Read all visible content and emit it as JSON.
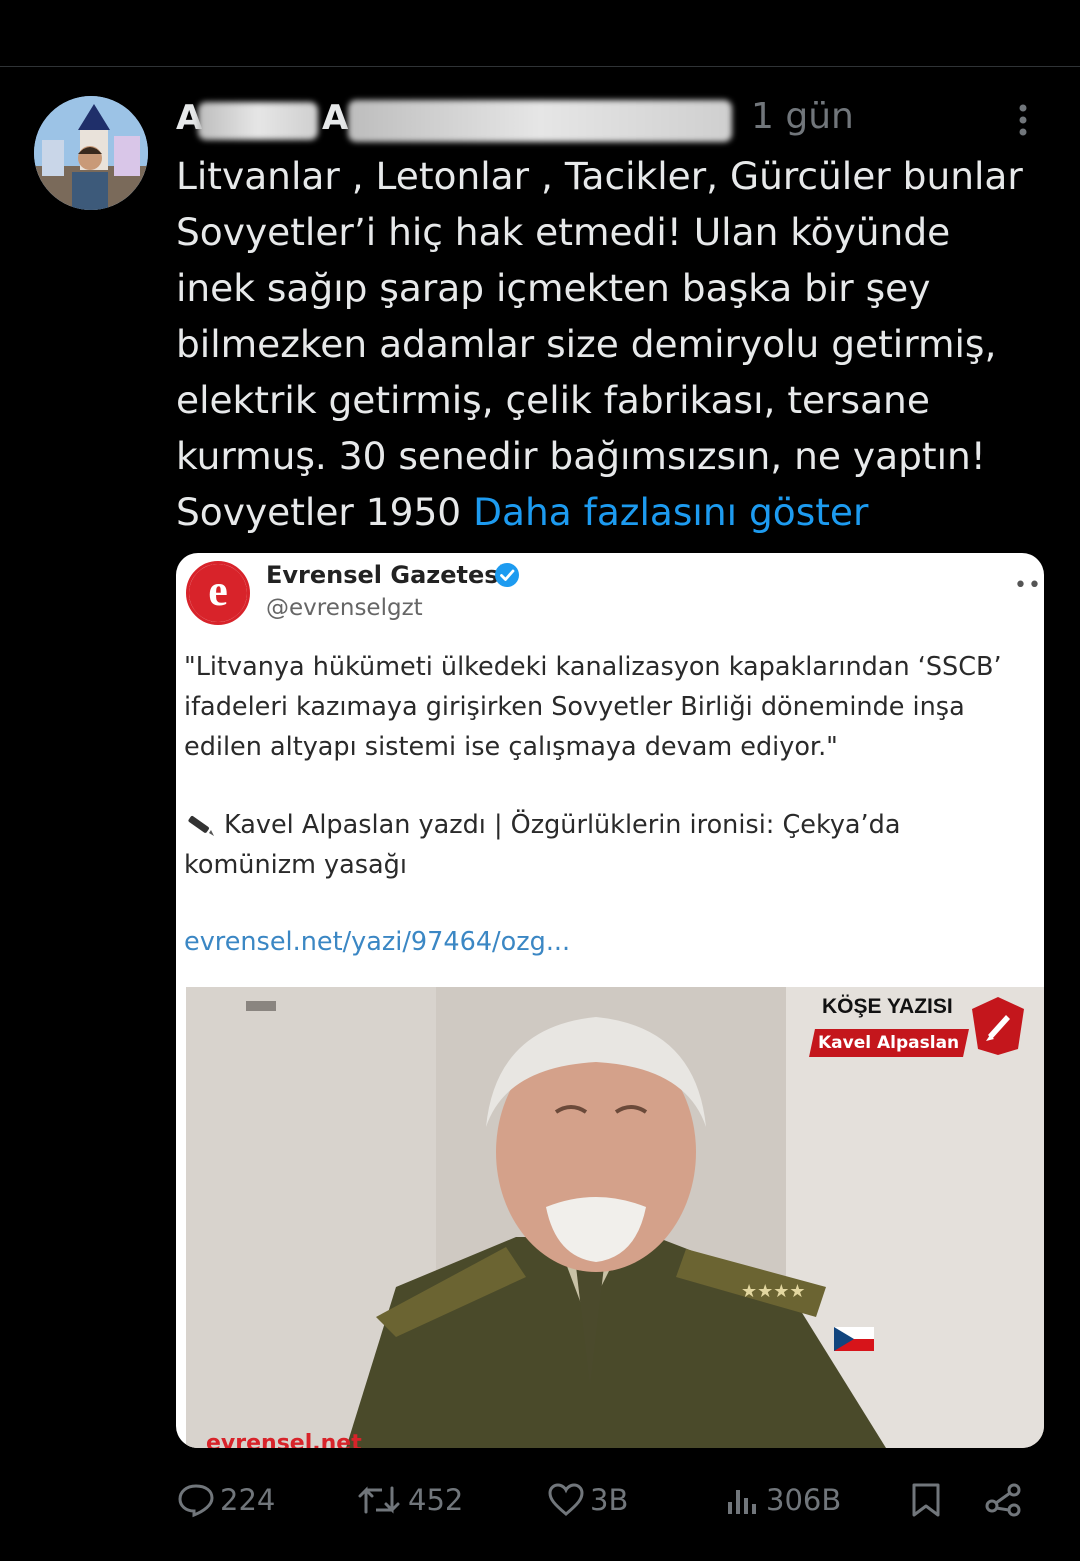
{
  "post": {
    "author_first": "A",
    "author_second": "A",
    "time": "1 gün",
    "text_lines": [
      "Litvanlar , Letonlar , Tacikler, Gürcüler bunlar",
      "Sovyetler’i hiç hak etmedi! Ulan köyünde",
      "inek sağıp şarap içmekten başka bir şey",
      "bilmezken adamlar size demiryolu getirmiş,",
      "elektrik getirmiş, çelik fabrikası, tersane",
      "kurmuş. 30 senedir bağımsızsın,  ne yaptın!",
      "Sovyetler 1950 "
    ],
    "show_more": "Daha fazlasını göster"
  },
  "quote": {
    "logo_letter": "e",
    "name": "Evrensel Gazetesi",
    "handle": "@evrenselgzt",
    "more": "•••",
    "body_lines": [
      "\"Litvanya hükümeti ülkedeki kanalizasyon kapaklarından ‘SSCB’",
      "ifadeleri kazımaya girişirken Sovyetler Birliği döneminde inşa",
      "edilen altyapı sistemi ise çalışmaya devam ediyor.\""
    ],
    "author_lines": [
      "Kavel Alpaslan yazdı | Özgürlüklerin ironisi: Çekya’da",
      "komünizm yasağı"
    ],
    "link": "evrensel.net/yazi/97464/ozg...",
    "image": {
      "badge_title": "KÖŞE YAZISI",
      "badge_author": "Kavel Alpaslan",
      "watermark": "evrensel.net"
    }
  },
  "actions": {
    "replies": "224",
    "reposts": "452",
    "likes": "3B",
    "views": "306B"
  },
  "colors": {
    "background": "#000000",
    "text": "#e7e9ea",
    "muted": "#71767b",
    "link": "#1d9bf0",
    "brand_red": "#d8232a"
  }
}
